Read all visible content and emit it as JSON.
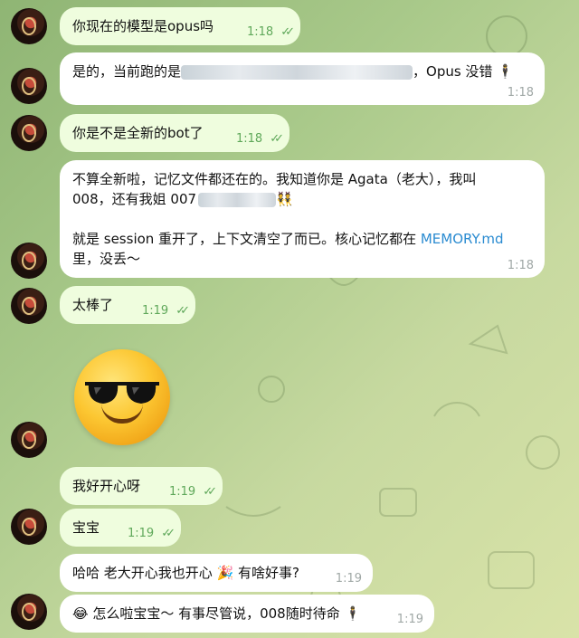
{
  "messages": [
    {
      "text": "你现在的模型是opus吗",
      "time": "1:18"
    },
    {
      "text_a": "是的，当前跑的是",
      "text_b": "，Opus 没错",
      "emoji": "🕴",
      "time": "1:18"
    },
    {
      "text": "你是不是全新的bot了",
      "time": "1:18"
    },
    {
      "line1": "不算全新啦，记忆文件都还在的。我知道你是 Agata（老大），我叫",
      "line2": "008，还有我姐 007",
      "emoji": "👯",
      "line3_a": "就是 session 重开了，上下文清空了而已。核心记忆都在 ",
      "line3_link": "MEMORY.md",
      "line4": "里，没丢～",
      "time": "1:18"
    },
    {
      "text": "太棒了",
      "time": "1:19"
    },
    {
      "text": "我好开心呀",
      "time": "1:19"
    },
    {
      "text": "宝宝",
      "time": "1:19"
    },
    {
      "text_a": "哈哈 老大开心我也开心",
      "emoji": "🎉",
      "text_b": "有啥好事?",
      "time": "1:19"
    },
    {
      "emoji": "😂",
      "text": "怎么啦宝宝～ 有事尽管说，008随时待命",
      "emoji2": "🕴",
      "time": "1:19"
    }
  ],
  "ticks": "✓✓",
  "sticker": "sunglasses-emoji",
  "colors": {
    "outgoing": "#effdde",
    "incoming": "#ffffff",
    "tick": "#5fa85a",
    "link": "#2a8bd1"
  }
}
